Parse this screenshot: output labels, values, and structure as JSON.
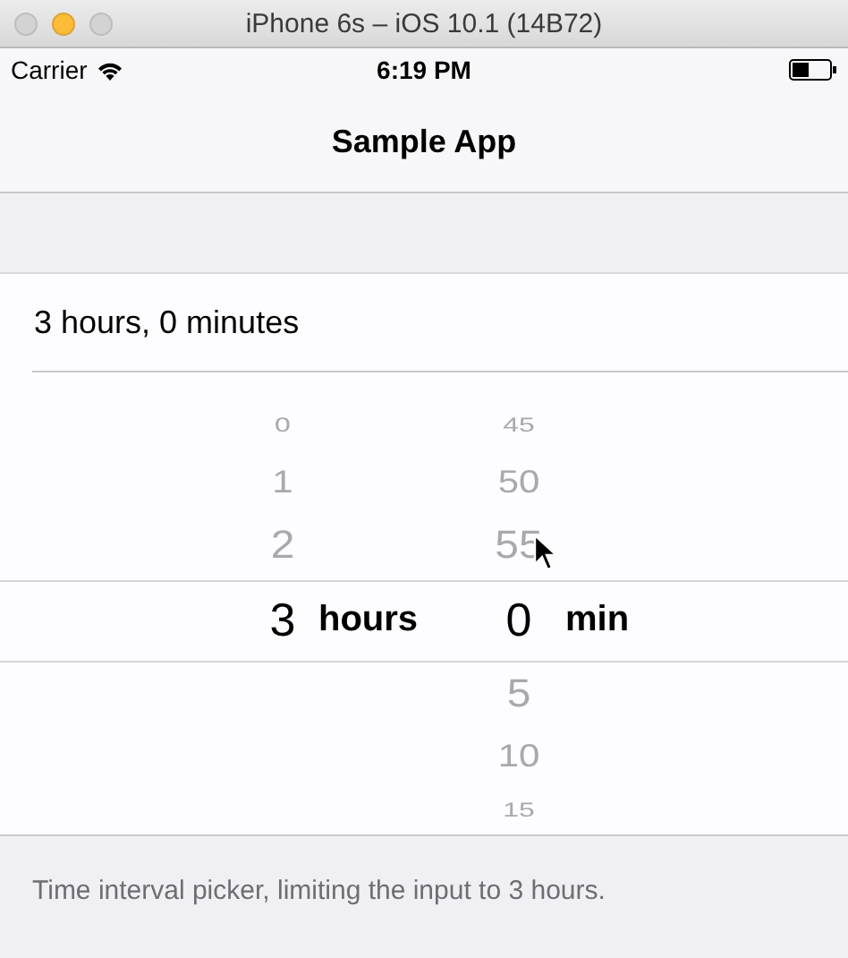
{
  "window": {
    "title": "iPhone 6s – iOS 10.1 (14B72)"
  },
  "status_bar": {
    "carrier": "Carrier",
    "time": "6:19 PM"
  },
  "nav_bar": {
    "title": "Sample App"
  },
  "value_cell": {
    "text": "3 hours, 0 minutes"
  },
  "picker": {
    "columns": [
      {
        "unit_label": "hours",
        "items": [
          {
            "text": "0",
            "selected": false
          },
          {
            "text": "1",
            "selected": false
          },
          {
            "text": "2",
            "selected": false
          },
          {
            "text": "3",
            "selected": true
          }
        ]
      },
      {
        "unit_label": "min",
        "items": [
          {
            "text": "45",
            "selected": false
          },
          {
            "text": "50",
            "selected": false
          },
          {
            "text": "55",
            "selected": false
          },
          {
            "text": "0",
            "selected": true
          },
          {
            "text": "5",
            "selected": false
          },
          {
            "text": "10",
            "selected": false
          },
          {
            "text": "15",
            "selected": false
          }
        ]
      }
    ]
  },
  "footer": {
    "text": "Time interval picker, limiting the input to 3 hours."
  }
}
